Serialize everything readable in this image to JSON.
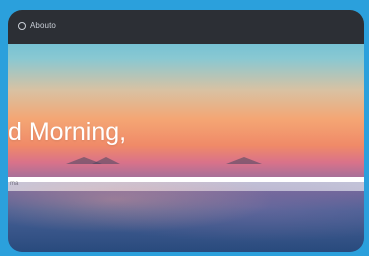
{
  "topbar": {
    "title": "Abouto",
    "icon": "globe-icon"
  },
  "main": {
    "greeting": "d Morning,"
  },
  "search": {
    "placeholder": "ma"
  },
  "colors": {
    "frame_bg": "#2ba0dc",
    "topbar_bg": "#2c2f35",
    "accent_text": "#ffffff"
  }
}
